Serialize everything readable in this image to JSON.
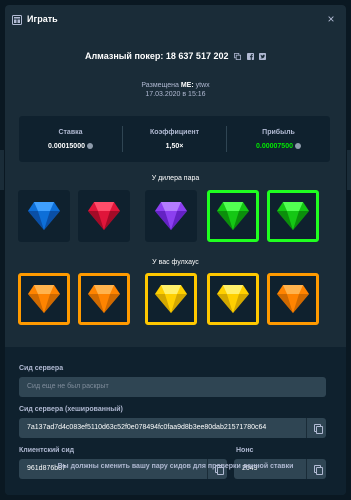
{
  "modal": {
    "title": "Играть",
    "close_glyph": "×"
  },
  "game": {
    "title": "Алмазный покер: 18 637 517 202",
    "placed_prefix": "Размещена",
    "placed_user_me": "ME:",
    "placed_user": "ytwx",
    "placed_date": "17.03.2020 в 15:16"
  },
  "stats": {
    "bet_label": "Ставка",
    "bet_value": "0.00015000",
    "multiplier_label": "Коэффициент",
    "multiplier_value": "1,50×",
    "profit_label": "Прибыль",
    "profit_value": "0.00007500"
  },
  "dealer": {
    "label": "У дилера пара",
    "gems": [
      {
        "color": "blue",
        "winning": false
      },
      {
        "color": "red",
        "winning": false
      },
      {
        "color": "purple",
        "winning": false
      },
      {
        "color": "green",
        "winning": true
      },
      {
        "color": "green",
        "winning": true
      }
    ]
  },
  "player": {
    "label": "У вас фулхаус",
    "gems": [
      {
        "color": "orange",
        "winning": true
      },
      {
        "color": "orange",
        "winning": true
      },
      {
        "color": "yellow",
        "winning": true
      },
      {
        "color": "yellow",
        "winning": true
      },
      {
        "color": "orange",
        "winning": true
      }
    ]
  },
  "fairness": {
    "server_seed_label": "Сид сервера",
    "server_seed_placeholder": "Сид еще не был раскрыт",
    "hashed_seed_label": "Сид сервера (хешированный)",
    "hashed_seed_value": "7a137ad7d4c083ef5110d63c52f0e078494fc0faa9d8b3ee80dab21571780c64",
    "client_seed_label": "Клиентский сид",
    "client_seed_value": "961d876b87",
    "nonce_label": "Нонс",
    "nonce_value": "2049",
    "footer_note": "Вы должны сменить вашу пару сидов для проверки данной ставки"
  },
  "colors": {
    "modal_bg": "#1a2c38",
    "dark_bg": "#0f212e",
    "input_bg": "#2f4553",
    "win_green": "#1fff20",
    "win_orange": "#ff9a00",
    "win_yellow": "#ffc800",
    "profit_green": "#00e701"
  },
  "icons": {
    "header": "game-table-icon",
    "close": "close-icon",
    "copy": "copy-icon",
    "facebook": "facebook-icon",
    "twitter": "twitter-icon",
    "coin": "bitcoin-coin-icon"
  }
}
